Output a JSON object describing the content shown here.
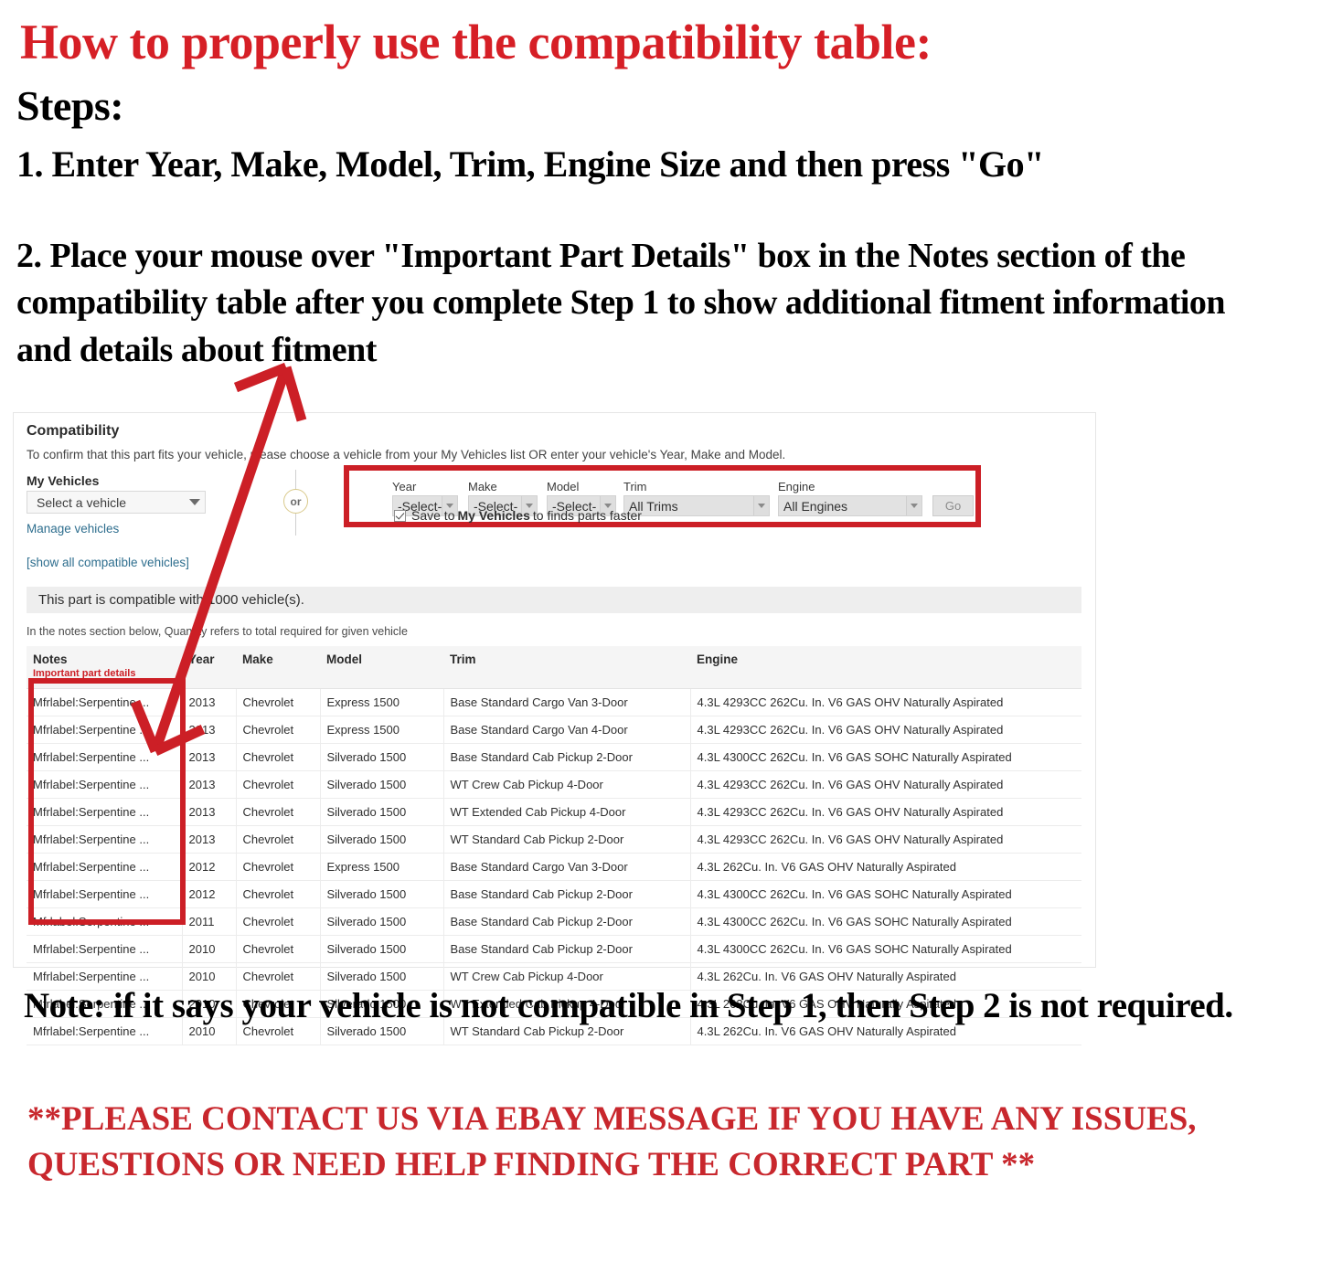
{
  "headline": "How to properly use the compatibility table:",
  "steps_label": "Steps:",
  "step1": "1. Enter Year, Make, Model, Trim, Engine Size and then press \"Go\"",
  "step2": "2. Place your mouse over \"Important Part Details\" box in the Notes section of the compatibility table after you complete Step 1 to show additional fitment information and details about fitment",
  "note": "Note: if it says your vehicle is not compatible in Step 1, then Step 2 is not required.",
  "contact": "**PLEASE CONTACT US VIA EBAY MESSAGE IF YOU HAVE ANY ISSUES, QUESTIONS OR NEED HELP FINDING THE CORRECT PART **",
  "colors": {
    "red_heading": "#d61f26",
    "callout_red": "#cc1f26",
    "link_blue": "#2e6e8e",
    "bar_gray": "#eeeeee",
    "or_gold": "#d9c98a"
  },
  "panel": {
    "title": "Compatibility",
    "subtitle": "To confirm that this part fits your vehicle, please choose a vehicle from your My Vehicles list OR enter your vehicle's Year, Make and Model.",
    "my_vehicles_label": "My Vehicles",
    "vehicle_select_value": "Select a vehicle",
    "manage_vehicles_link": "Manage vehicles",
    "show_all_link": "[show all compatible vehicles]",
    "or_label": "or",
    "form": {
      "year_label": "Year",
      "year_value": "-Select-",
      "make_label": "Make",
      "make_value": "-Select-",
      "model_label": "Model",
      "model_value": "-Select-",
      "trim_label": "Trim",
      "trim_value": "All Trims",
      "engine_label": "Engine",
      "engine_value": "All Engines",
      "go_label": "Go",
      "save_prefix": "Save to",
      "save_bold": "My Vehicles",
      "save_suffix": "to finds parts faster"
    },
    "compat_message": "This part is compatible with 1000 vehicle(s).",
    "quantity_note": "In the notes section below, Quantity refers to total required for given vehicle"
  },
  "table": {
    "columns": [
      "Notes",
      "Year",
      "Make",
      "Model",
      "Trim",
      "Engine"
    ],
    "notes_subheader": "Important part details",
    "rows": [
      {
        "notes": "Mfrlabel:Serpentine ...",
        "year": "2013",
        "make": "Chevrolet",
        "model": "Express 1500",
        "trim": "Base Standard Cargo Van 3-Door",
        "engine": "4.3L 4293CC 262Cu. In. V6 GAS OHV Naturally Aspirated"
      },
      {
        "notes": "Mfrlabel:Serpentine ...",
        "year": "2013",
        "make": "Chevrolet",
        "model": "Express 1500",
        "trim": "Base Standard Cargo Van 4-Door",
        "engine": "4.3L 4293CC 262Cu. In. V6 GAS OHV Naturally Aspirated"
      },
      {
        "notes": "Mfrlabel:Serpentine ...",
        "year": "2013",
        "make": "Chevrolet",
        "model": "Silverado 1500",
        "trim": "Base Standard Cab Pickup 2-Door",
        "engine": "4.3L 4300CC 262Cu. In. V6 GAS SOHC Naturally Aspirated"
      },
      {
        "notes": "Mfrlabel:Serpentine ...",
        "year": "2013",
        "make": "Chevrolet",
        "model": "Silverado 1500",
        "trim": "WT Crew Cab Pickup 4-Door",
        "engine": "4.3L 4293CC 262Cu. In. V6 GAS OHV Naturally Aspirated"
      },
      {
        "notes": "Mfrlabel:Serpentine ...",
        "year": "2013",
        "make": "Chevrolet",
        "model": "Silverado 1500",
        "trim": "WT Extended Cab Pickup 4-Door",
        "engine": "4.3L 4293CC 262Cu. In. V6 GAS OHV Naturally Aspirated"
      },
      {
        "notes": "Mfrlabel:Serpentine ...",
        "year": "2013",
        "make": "Chevrolet",
        "model": "Silverado 1500",
        "trim": "WT Standard Cab Pickup 2-Door",
        "engine": "4.3L 4293CC 262Cu. In. V6 GAS OHV Naturally Aspirated"
      },
      {
        "notes": "Mfrlabel:Serpentine ...",
        "year": "2012",
        "make": "Chevrolet",
        "model": "Express 1500",
        "trim": "Base Standard Cargo Van 3-Door",
        "engine": "4.3L 262Cu. In. V6 GAS OHV Naturally Aspirated"
      },
      {
        "notes": "Mfrlabel:Serpentine ...",
        "year": "2012",
        "make": "Chevrolet",
        "model": "Silverado 1500",
        "trim": "Base Standard Cab Pickup 2-Door",
        "engine": "4.3L 4300CC 262Cu. In. V6 GAS SOHC Naturally Aspirated"
      },
      {
        "notes": "Mfrlabel:Serpentine ...",
        "year": "2011",
        "make": "Chevrolet",
        "model": "Silverado 1500",
        "trim": "Base Standard Cab Pickup 2-Door",
        "engine": "4.3L 4300CC 262Cu. In. V6 GAS SOHC Naturally Aspirated"
      },
      {
        "notes": "Mfrlabel:Serpentine ...",
        "year": "2010",
        "make": "Chevrolet",
        "model": "Silverado 1500",
        "trim": "Base Standard Cab Pickup 2-Door",
        "engine": "4.3L 4300CC 262Cu. In. V6 GAS SOHC Naturally Aspirated"
      },
      {
        "notes": "Mfrlabel:Serpentine ...",
        "year": "2010",
        "make": "Chevrolet",
        "model": "Silverado 1500",
        "trim": "WT Crew Cab Pickup 4-Door",
        "engine": "4.3L 262Cu. In. V6 GAS OHV Naturally Aspirated"
      },
      {
        "notes": "Mfrlabel:Serpentine ...",
        "year": "2010",
        "make": "Chevrolet",
        "model": "Silverado 1500",
        "trim": "WT Extended Cab Pickup 4-Door",
        "engine": "4.3L 262Cu. In. V6 GAS OHV Naturally Aspirated"
      },
      {
        "notes": "Mfrlabel:Serpentine ...",
        "year": "2010",
        "make": "Chevrolet",
        "model": "Silverado 1500",
        "trim": "WT Standard Cab Pickup 2-Door",
        "engine": "4.3L 262Cu. In. V6 GAS OHV Naturally Aspirated"
      }
    ]
  }
}
